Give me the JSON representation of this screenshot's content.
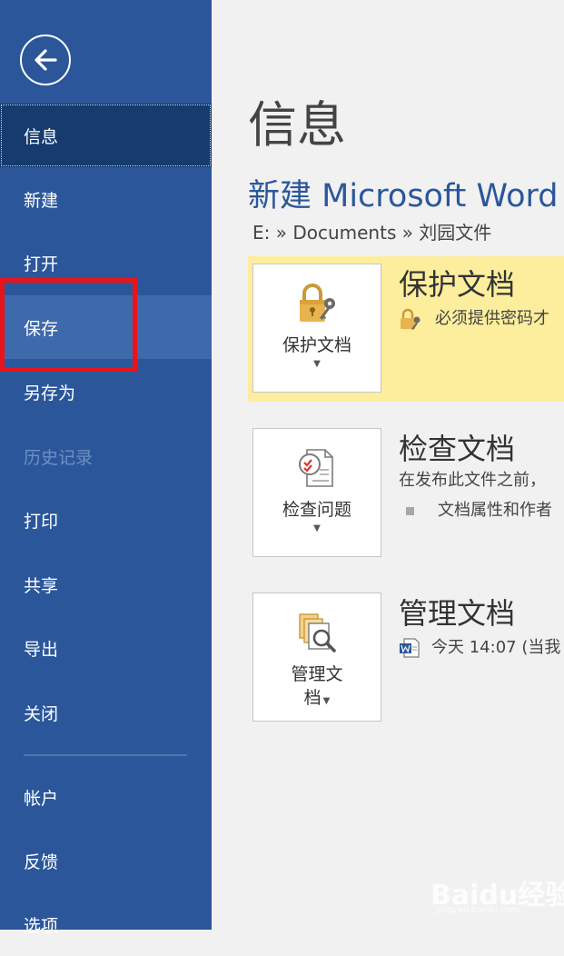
{
  "sidebar": {
    "items": [
      {
        "label": "信息",
        "state": "selected"
      },
      {
        "label": "新建",
        "state": "normal"
      },
      {
        "label": "打开",
        "state": "normal"
      },
      {
        "label": "保存",
        "state": "hover"
      },
      {
        "label": "另存为",
        "state": "normal"
      },
      {
        "label": "历史记录",
        "state": "disabled"
      },
      {
        "label": "打印",
        "state": "normal"
      },
      {
        "label": "共享",
        "state": "normal"
      },
      {
        "label": "导出",
        "state": "normal"
      },
      {
        "label": "关闭",
        "state": "normal"
      },
      {
        "label": "帐户",
        "state": "normal"
      },
      {
        "label": "反馈",
        "state": "normal"
      },
      {
        "label": "选项",
        "state": "normal"
      }
    ],
    "back_icon": "arrow-left-circle-icon"
  },
  "main": {
    "page_title": "信息",
    "doc_title": "新建 Microsoft Word",
    "breadcrumb": "E: » Documents » 刘园文件",
    "sections": [
      {
        "tile_label": "保护文档",
        "heading": "保护文档",
        "line1": "必须提供密码才",
        "icon": "lock-key-icon"
      },
      {
        "tile_label": "检查问题",
        "heading": "检查文档",
        "line1": "在发布此文件之前，",
        "line2": "文档属性和作者",
        "icon": "inspect-document-icon"
      },
      {
        "tile_label_1": "管理文",
        "tile_label_2": "档",
        "heading": "管理文档",
        "line1": "今天 14:07 (当我",
        "icon": "manage-versions-icon"
      }
    ]
  },
  "watermark": {
    "logo": "Baidu经验",
    "sub": "jingyan.baidu.com"
  },
  "colors": {
    "sidebar_bg": "#2b579a",
    "sidebar_selected": "#163b6f",
    "sidebar_hover": "#3e6aab",
    "accent": "#2b579a",
    "warning_bg": "#fcee9c",
    "highlight": "#e8141b"
  }
}
